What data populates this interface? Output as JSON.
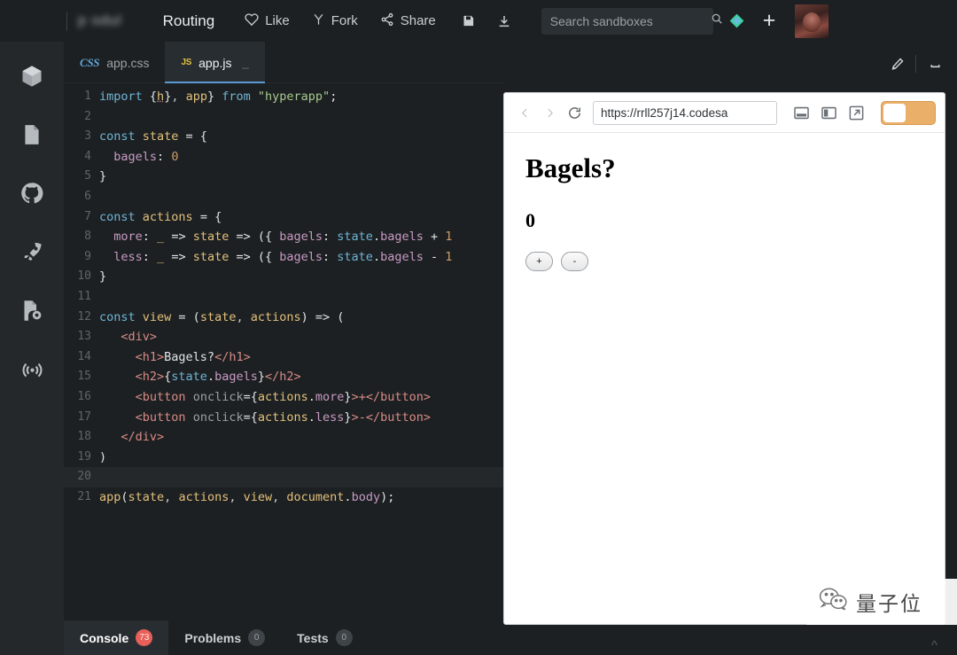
{
  "topbar": {
    "blurred_left": "p  odul",
    "routing_label": "Routing",
    "like_label": "Like",
    "fork_label": "Fork",
    "share_label": "Share",
    "save_icon": "floppy-disk-icon",
    "download_icon": "download-icon",
    "search_placeholder": "Search sandboxes",
    "search_value": "",
    "plus_label": "+",
    "icons": {
      "heart": "heart-icon",
      "fork": "fork-icon",
      "share": "share-nodes-icon",
      "magnifier": "search-icon",
      "diamond": "diamond-badge-icon",
      "avatar": "user-avatar"
    },
    "bg": "#1c2022"
  },
  "sidebar": {
    "items": [
      {
        "name": "sidebar-item-project",
        "icon": "cube-icon"
      },
      {
        "name": "sidebar-item-files",
        "icon": "file-icon"
      },
      {
        "name": "sidebar-item-github",
        "icon": "github-icon"
      },
      {
        "name": "sidebar-item-deploy",
        "icon": "rocket-icon"
      },
      {
        "name": "sidebar-item-config",
        "icon": "file-gear-icon"
      },
      {
        "name": "sidebar-item-live",
        "icon": "broadcast-icon"
      }
    ],
    "bg": "#24282b"
  },
  "editor": {
    "tabs": [
      {
        "label": "app.css",
        "filetype": "CSS",
        "active": false
      },
      {
        "label": "app.js",
        "filetype": "JS",
        "active": true,
        "dash": "_"
      }
    ],
    "corner_icons": [
      {
        "name": "pen-edit-icon"
      },
      {
        "name": "minimize-icon"
      }
    ],
    "bg": "#1c2022",
    "highlight_line": 20,
    "lines": [
      {
        "n": 1,
        "tokens": [
          [
            "t-kw",
            "import"
          ],
          [
            "t-plain",
            " {"
          ],
          [
            "t-var t-under",
            "h"
          ],
          [
            "t-plain",
            "}"
          ],
          [
            "t-punc",
            ", "
          ],
          [
            "t-var",
            "app"
          ],
          [
            "t-plain",
            "} "
          ],
          [
            "t-kw",
            "from"
          ],
          [
            "t-plain",
            " "
          ],
          [
            "t-str",
            "\"hyperapp\""
          ],
          [
            "t-plain",
            ";"
          ]
        ]
      },
      {
        "n": 2,
        "tokens": []
      },
      {
        "n": 3,
        "tokens": [
          [
            "t-kw",
            "const"
          ],
          [
            "t-plain",
            " "
          ],
          [
            "t-var",
            "state"
          ],
          [
            "t-plain",
            " = {"
          ]
        ]
      },
      {
        "n": 4,
        "tokens": [
          [
            "t-plain",
            "  "
          ],
          [
            "t-prop",
            "bagels"
          ],
          [
            "t-plain",
            ": "
          ],
          [
            "t-num",
            "0"
          ]
        ]
      },
      {
        "n": 5,
        "tokens": [
          [
            "t-plain",
            "}"
          ]
        ]
      },
      {
        "n": 6,
        "tokens": []
      },
      {
        "n": 7,
        "tokens": [
          [
            "t-kw",
            "const"
          ],
          [
            "t-plain",
            " "
          ],
          [
            "t-var",
            "actions"
          ],
          [
            "t-plain",
            " = {"
          ]
        ]
      },
      {
        "n": 8,
        "tokens": [
          [
            "t-plain",
            "  "
          ],
          [
            "t-prop",
            "more"
          ],
          [
            "t-plain",
            ": "
          ],
          [
            "t-var",
            "_"
          ],
          [
            "t-plain",
            " => "
          ],
          [
            "t-var",
            "state"
          ],
          [
            "t-plain",
            " => ({ "
          ],
          [
            "t-prop",
            "bagels"
          ],
          [
            "t-plain",
            ": "
          ],
          [
            "t-kw",
            "state"
          ],
          [
            "t-plain",
            "."
          ],
          [
            "t-prop",
            "bagels"
          ],
          [
            "t-plain",
            " + "
          ],
          [
            "t-num",
            "1"
          ]
        ]
      },
      {
        "n": 9,
        "tokens": [
          [
            "t-plain",
            "  "
          ],
          [
            "t-prop",
            "less"
          ],
          [
            "t-plain",
            ": "
          ],
          [
            "t-var",
            "_"
          ],
          [
            "t-plain",
            " => "
          ],
          [
            "t-var",
            "state"
          ],
          [
            "t-plain",
            " => ({ "
          ],
          [
            "t-prop",
            "bagels"
          ],
          [
            "t-plain",
            ": "
          ],
          [
            "t-kw",
            "state"
          ],
          [
            "t-plain",
            "."
          ],
          [
            "t-prop",
            "bagels"
          ],
          [
            "t-plain",
            " - "
          ],
          [
            "t-num",
            "1"
          ]
        ]
      },
      {
        "n": 10,
        "tokens": [
          [
            "t-plain",
            "}"
          ]
        ]
      },
      {
        "n": 11,
        "tokens": []
      },
      {
        "n": 12,
        "tokens": [
          [
            "t-kw",
            "const"
          ],
          [
            "t-plain",
            " "
          ],
          [
            "t-var",
            "view"
          ],
          [
            "t-plain",
            " = ("
          ],
          [
            "t-var",
            "state"
          ],
          [
            "t-punc",
            ", "
          ],
          [
            "t-var",
            "actions"
          ],
          [
            "t-plain",
            ") => ("
          ]
        ]
      },
      {
        "n": 13,
        "tokens": [
          [
            "t-plain",
            "   "
          ],
          [
            "t-tag",
            "<div>"
          ]
        ]
      },
      {
        "n": 14,
        "tokens": [
          [
            "t-plain",
            "     "
          ],
          [
            "t-tag",
            "<h1>"
          ],
          [
            "t-plain",
            "Bagels?"
          ],
          [
            "t-tag",
            "</h1>"
          ]
        ]
      },
      {
        "n": 15,
        "tokens": [
          [
            "t-plain",
            "     "
          ],
          [
            "t-tag",
            "<h2>"
          ],
          [
            "t-plain",
            "{"
          ],
          [
            "t-kw",
            "state"
          ],
          [
            "t-plain",
            "."
          ],
          [
            "t-prop",
            "bagels"
          ],
          [
            "t-plain",
            "}"
          ],
          [
            "t-tag",
            "</h2>"
          ]
        ]
      },
      {
        "n": 16,
        "tokens": [
          [
            "t-plain",
            "     "
          ],
          [
            "t-tag",
            "<button"
          ],
          [
            "t-plain",
            " "
          ],
          [
            "t-dim",
            "onclick"
          ],
          [
            "t-plain",
            "={"
          ],
          [
            "t-var",
            "actions"
          ],
          [
            "t-plain",
            "."
          ],
          [
            "t-prop",
            "more"
          ],
          [
            "t-plain",
            "}"
          ],
          [
            "t-tag",
            ">+</button>"
          ]
        ]
      },
      {
        "n": 17,
        "tokens": [
          [
            "t-plain",
            "     "
          ],
          [
            "t-tag",
            "<button"
          ],
          [
            "t-plain",
            " "
          ],
          [
            "t-dim",
            "onclick"
          ],
          [
            "t-plain",
            "={"
          ],
          [
            "t-var",
            "actions"
          ],
          [
            "t-plain",
            "."
          ],
          [
            "t-prop",
            "less"
          ],
          [
            "t-plain",
            "}"
          ],
          [
            "t-tag",
            ">-</button>"
          ]
        ]
      },
      {
        "n": 18,
        "tokens": [
          [
            "t-plain",
            "   "
          ],
          [
            "t-tag",
            "</div>"
          ]
        ]
      },
      {
        "n": 19,
        "tokens": [
          [
            "t-plain",
            ")"
          ]
        ]
      },
      {
        "n": 20,
        "tokens": []
      },
      {
        "n": 21,
        "tokens": [
          [
            "t-var",
            "app"
          ],
          [
            "t-plain",
            "("
          ],
          [
            "t-var",
            "state"
          ],
          [
            "t-punc",
            ", "
          ],
          [
            "t-var",
            "actions"
          ],
          [
            "t-punc",
            ", "
          ],
          [
            "t-var",
            "view"
          ],
          [
            "t-punc",
            ", "
          ],
          [
            "t-var",
            "document"
          ],
          [
            "t-plain",
            "."
          ],
          [
            "t-prop",
            "body"
          ],
          [
            "t-plain",
            ");"
          ]
        ]
      }
    ]
  },
  "bottom_tabs": [
    {
      "label": "Console",
      "count": "73",
      "style": "red",
      "active": true
    },
    {
      "label": "Problems",
      "count": "0",
      "style": "gray",
      "active": false
    },
    {
      "label": "Tests",
      "count": "0",
      "style": "gray",
      "active": false
    }
  ],
  "preview": {
    "url": "https://rrll257j14.codesa",
    "back_icon": "chevron-left-icon",
    "forward_icon": "chevron-right-icon",
    "reload_icon": "reload-icon",
    "icons": [
      {
        "name": "split-horizontal-icon"
      },
      {
        "name": "split-vertical-icon"
      },
      {
        "name": "open-external-icon"
      }
    ],
    "toggle_on": true,
    "toggle_color": "#eab06a",
    "page": {
      "heading": "Bagels?",
      "count": "0",
      "plus_button": "+",
      "minus_button": "-"
    }
  },
  "watermark": {
    "text": "量子位",
    "icon": "wechat-icon",
    "chevron": "^"
  }
}
